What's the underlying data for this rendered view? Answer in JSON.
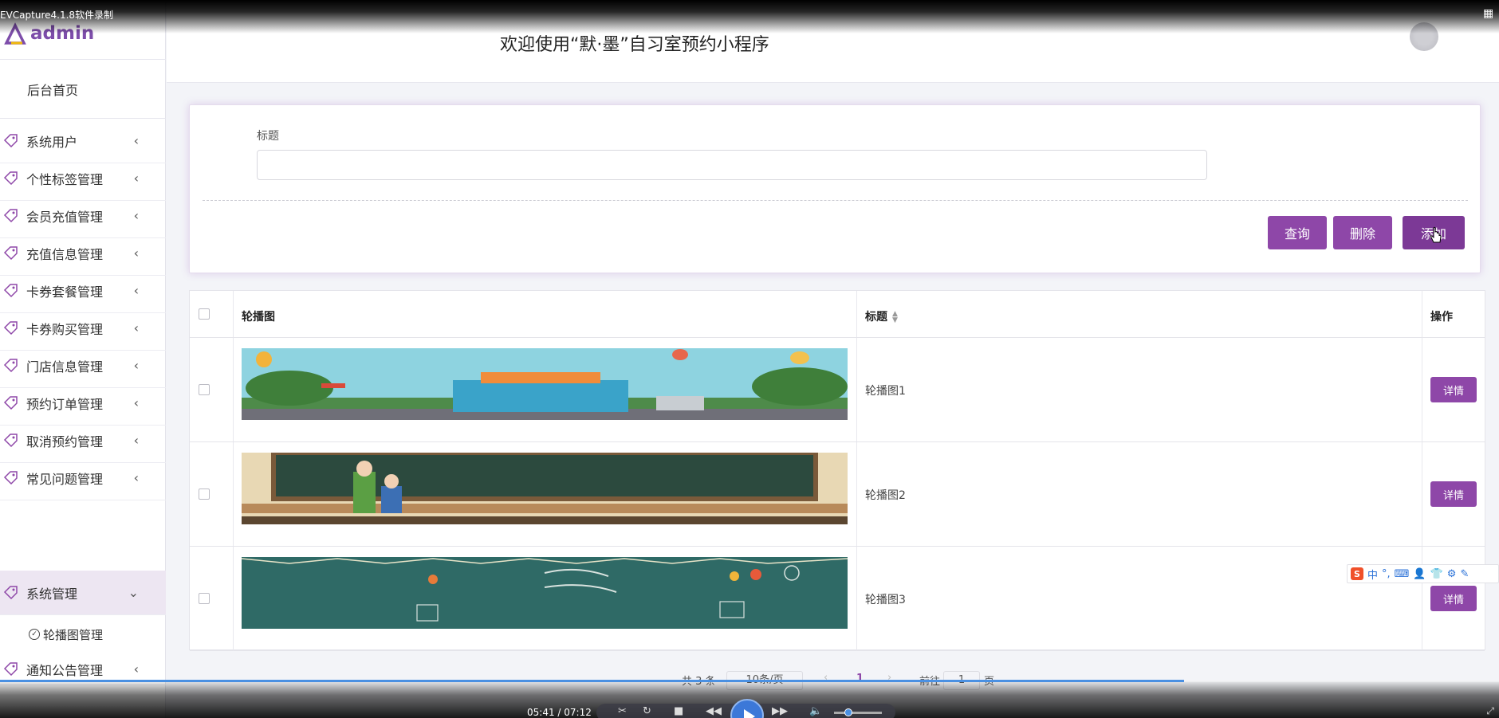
{
  "recorder": {
    "label": "EVCapture4.1.8软件录制",
    "time": "05:41 / 07:12",
    "progress": 0.79,
    "volume": 0.3
  },
  "logo": {
    "text": "admin",
    "color": "#7d4daa"
  },
  "header": {
    "welcome": "欢迎使用“默·墨”自习室预约小程序"
  },
  "sidebar": {
    "home": "后台首页",
    "items": [
      {
        "label": "系统用户",
        "chevron": "chevron-left-icon"
      },
      {
        "label": "个性标签管理",
        "chevron": "chevron-left-icon"
      },
      {
        "label": "会员充值管理",
        "chevron": "chevron-left-icon"
      },
      {
        "label": "充值信息管理",
        "chevron": "chevron-left-icon"
      },
      {
        "label": "卡券套餐管理",
        "chevron": "chevron-left-icon"
      },
      {
        "label": "卡券购买管理",
        "chevron": "chevron-left-icon"
      },
      {
        "label": "门店信息管理",
        "chevron": "chevron-left-icon"
      },
      {
        "label": "预约订单管理",
        "chevron": "chevron-left-icon"
      },
      {
        "label": "取消预约管理",
        "chevron": "chevron-left-icon"
      },
      {
        "label": "常见问题管理",
        "chevron": "chevron-left-icon"
      },
      {
        "label": "系统管理",
        "chevron": "chevron-down-icon",
        "active": true
      },
      {
        "label": "通知公告管理",
        "chevron": "chevron-left-icon"
      }
    ],
    "sub_item": "轮播图管理"
  },
  "search": {
    "field_label": "标题",
    "value": "",
    "placeholder": "",
    "buttons": {
      "query": "查询",
      "delete": "删除",
      "add": "添加"
    }
  },
  "table": {
    "headers": {
      "image": "轮播图",
      "title": "标题",
      "actions": "操作"
    },
    "rows": [
      {
        "title": "轮播图1",
        "action": "详情"
      },
      {
        "title": "轮播图2",
        "action": "详情"
      },
      {
        "title": "轮播图3",
        "action": "详情"
      }
    ]
  },
  "pagination": {
    "total": "共 3 条",
    "page_size": "10条/页",
    "current_page": "1",
    "goto_label": "前往",
    "goto_value": "1",
    "page_suffix": "页"
  },
  "ime": {
    "lang": "中"
  },
  "colors": {
    "accent": "#8e47a8",
    "accent_dark": "#7c3996",
    "active_bg": "#ede6f2"
  }
}
